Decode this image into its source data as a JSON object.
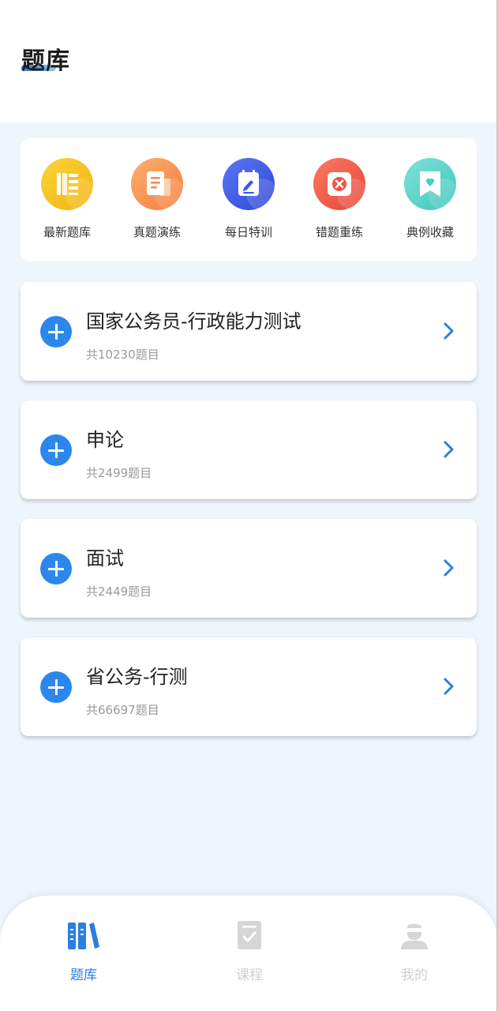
{
  "header": {
    "title": "题库"
  },
  "quick_actions": [
    {
      "label": "最新题库",
      "icon": "book-list-icon",
      "color": "#f6c21a"
    },
    {
      "label": "真题演练",
      "icon": "document-icon",
      "color": "#f58a46"
    },
    {
      "label": "每日特训",
      "icon": "edit-note-icon",
      "color": "#3b57e6"
    },
    {
      "label": "错题重练",
      "icon": "error-x-icon",
      "color": "#ef5544"
    },
    {
      "label": "典例收藏",
      "icon": "bookmark-heart-icon",
      "color": "#47cfc6"
    }
  ],
  "subjects": [
    {
      "name": "国家公务员-行政能力测试",
      "count": "共10230题目"
    },
    {
      "name": "申论",
      "count": "共2499题目"
    },
    {
      "name": "面试",
      "count": "共2449题目"
    },
    {
      "name": "省公务-行测",
      "count": "共66697题目"
    }
  ],
  "tabbar": [
    {
      "label": "题库",
      "active": true,
      "icon": "question-bank-icon"
    },
    {
      "label": "课程",
      "active": false,
      "icon": "course-icon"
    },
    {
      "label": "我的",
      "active": false,
      "icon": "profile-icon"
    }
  ],
  "colors": {
    "accent": "#2c87ec",
    "active_tab": "#2a7fe0",
    "inactive_tab": "#cfcfcf",
    "background": "#eff5fd"
  }
}
